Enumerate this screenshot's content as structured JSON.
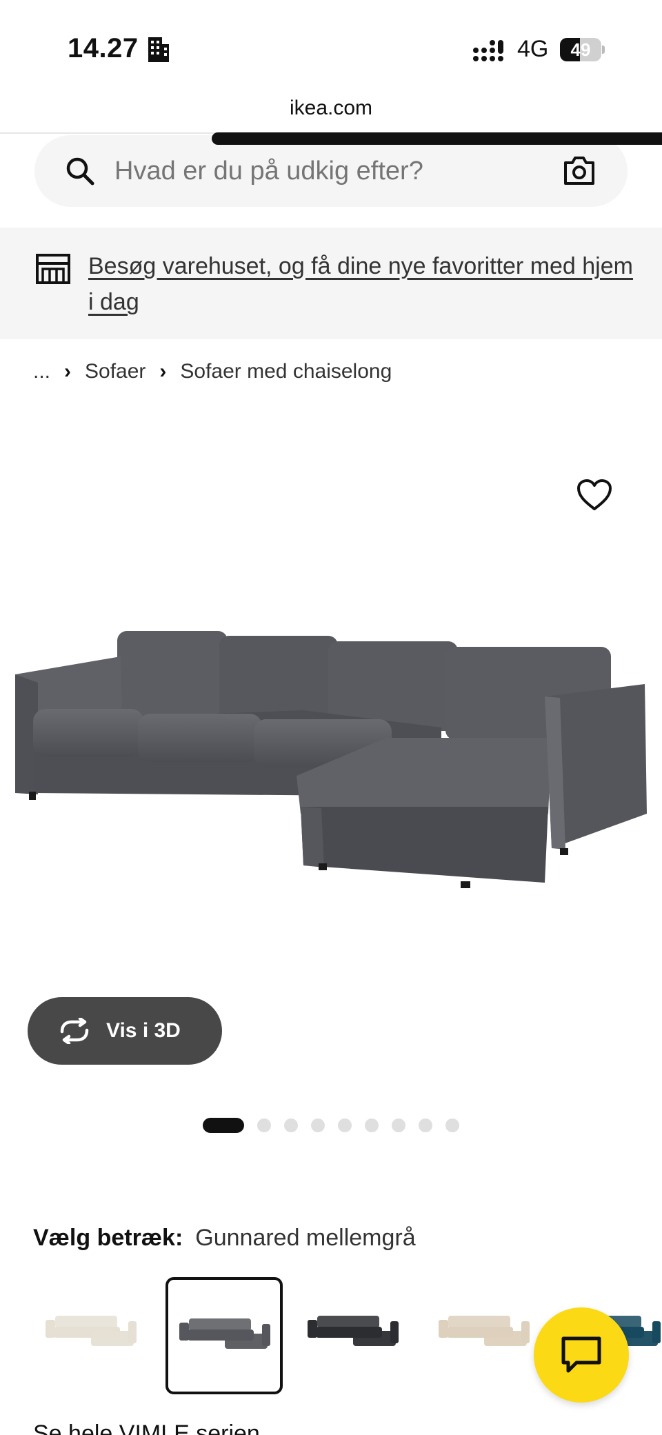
{
  "status_bar": {
    "time": "14.27",
    "network": "4G",
    "battery_level": "49",
    "icons": [
      "building-icon",
      "signal-icon",
      "battery-icon"
    ]
  },
  "browser": {
    "url": "ikea.com",
    "load_progress_percent": 68
  },
  "search": {
    "placeholder": "Hvad er du på udkig efter?",
    "icons": [
      "search-icon",
      "camera-icon"
    ]
  },
  "banner": {
    "text": "Besøg varehuset, og få dine nye favoritter med hjem i dag",
    "icon": "store-icon"
  },
  "breadcrumb": {
    "ellipsis": "...",
    "items": [
      "Sofaer",
      "Sofaer med chaiselong"
    ]
  },
  "product": {
    "view_3d_label": "Vis i 3D",
    "image_count": 9,
    "active_image_index": 0
  },
  "cover": {
    "label": "Vælg betræk:",
    "selected_value": "Gunnared mellemgrå",
    "swatches": [
      {
        "color": "#e6e0d4",
        "name": "beige-sofa"
      },
      {
        "color": "#55575c",
        "name": "grey-sofa",
        "selected": true
      },
      {
        "color": "#2c2d30",
        "name": "dark-grey-sofa"
      },
      {
        "color": "#ddd0bc",
        "name": "light-beige-sofa"
      },
      {
        "color": "#174a5e",
        "name": "teal-sofa"
      }
    ]
  },
  "series_link": "Se hele VIMLE serien",
  "colors": {
    "accent_yellow": "#fbd914",
    "button_dark": "#484848",
    "banner_bg": "#f5f5f5"
  }
}
